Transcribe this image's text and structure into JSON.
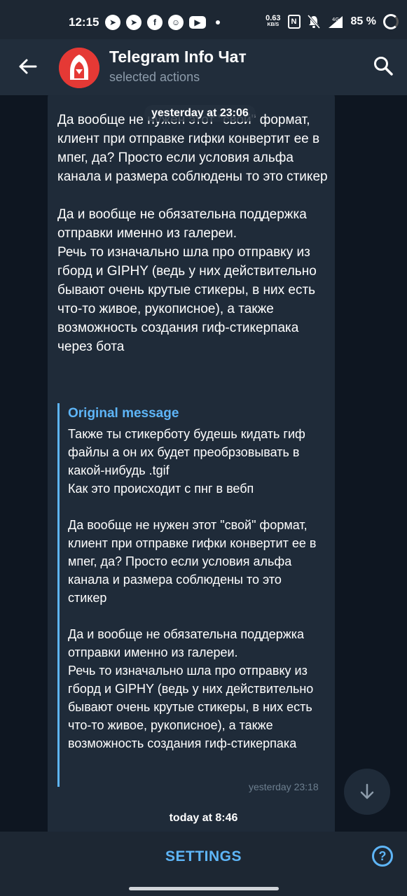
{
  "status_bar": {
    "time": "12:15",
    "net_speed": "0.63",
    "net_unit": "KB/S",
    "nfc": "N",
    "network": "4G",
    "battery": "85 %"
  },
  "header": {
    "title": "Telegram Info Чат",
    "subtitle": "selected actions"
  },
  "chat": {
    "date_label": "yesterday at 23:06",
    "message": {
      "text": "Да вообще не нужен этот \"свой\" формат, клиент при отправке гифки конвертит ее в мпег, да? Просто если условия альфа канала и размера соблюдены то это стикер\n\nДа и вообще не обязательна поддержка отправки именно из галереи.\nРечь то изначально шла про отправку из гборд и GIPHY (ведь у них действительно бывают очень крутые стикеры, в них есть что-то живое, рукописное), а также возможность создания гиф-стикерпака через бота",
      "quote_title": "Original message",
      "quote_text": "Также ты стикерботу будешь кидать гиф файлы а он их будет преобрзовывать в какой-нибудь .tgif\nКак это происходит с пнг в вебп\n\nДа вообще не нужен этот \"свой\" формат, клиент при отправке гифки конвертит ее в мпег, да? Просто если условия альфа канала и размера соблюдены то это стикер\n\nДа и вообще не обязательна поддержка отправки именно из галереи.\nРечь то изначально шла про отправку из гборд и GIPHY (ведь у них действительно бывают очень крутые стикеры, в них есть что-то живое, рукописное), а также возможность создания гиф-стикерпака",
      "time": "yesterday 23:18"
    },
    "today_label": "today at 8:46"
  },
  "bottom": {
    "settings_label": "SETTINGS",
    "help_label": "?"
  },
  "colors": {
    "accent": "#5eb5f7",
    "header_bg": "#212d3b",
    "chat_bg": "#0e1621",
    "bubble_bg": "#1f2b39"
  }
}
